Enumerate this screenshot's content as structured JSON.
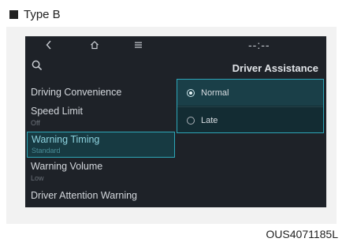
{
  "header": {
    "type_label": "Type B"
  },
  "topbar": {
    "back_icon": "chevron-left-icon",
    "home_icon": "home-icon",
    "menu_icon": "hamburger-menu-icon",
    "time_text": "--:--"
  },
  "sidebar": {
    "search_icon": "search-icon",
    "items": [
      {
        "label": "Driving Convenience",
        "sub": ""
      },
      {
        "label": "Speed Limit",
        "sub": "Off"
      },
      {
        "label": "Warning Timing",
        "sub": "Standard"
      },
      {
        "label": "Warning Volume",
        "sub": "Low"
      },
      {
        "label": "Driver Attention Warning",
        "sub": ""
      }
    ],
    "selected_index": 2
  },
  "main": {
    "title": "Driver Assistance",
    "options": [
      {
        "label": "Normal",
        "selected": true
      },
      {
        "label": "Late",
        "selected": false
      }
    ]
  },
  "footer": {
    "code": "OUS4071185L"
  },
  "colors": {
    "accent": "#2ea6b8",
    "screen_bg": "#1e2228"
  }
}
